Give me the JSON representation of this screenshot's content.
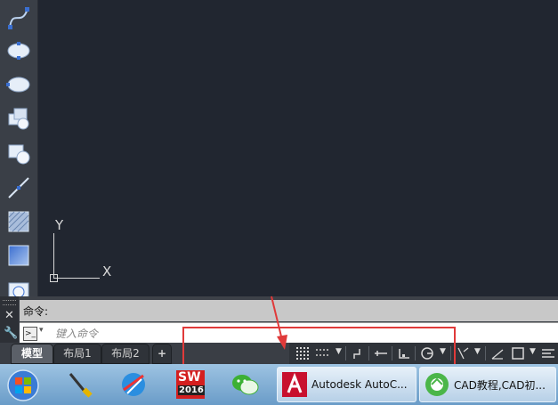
{
  "canvas": {
    "ucs_y": "Y",
    "ucs_x": "X"
  },
  "command": {
    "label": "命令:",
    "placeholder": "键入命令",
    "prompt_icon": "terminal-icon",
    "dropdown": "▾"
  },
  "tabs": [
    {
      "label": "模型"
    },
    {
      "label": "布局1"
    },
    {
      "label": "布局2"
    },
    {
      "label": "+"
    }
  ],
  "taskbar": {
    "sw_badge": "SW",
    "sw_year": "2016",
    "autocad_label": "Autodesk AutoC...",
    "browser_label": "CAD教程,CAD初..."
  },
  "colors": {
    "canvas_bg": "#212630",
    "highlight": "#e03a3a",
    "taskbar_bg": "#7fb0d8"
  }
}
